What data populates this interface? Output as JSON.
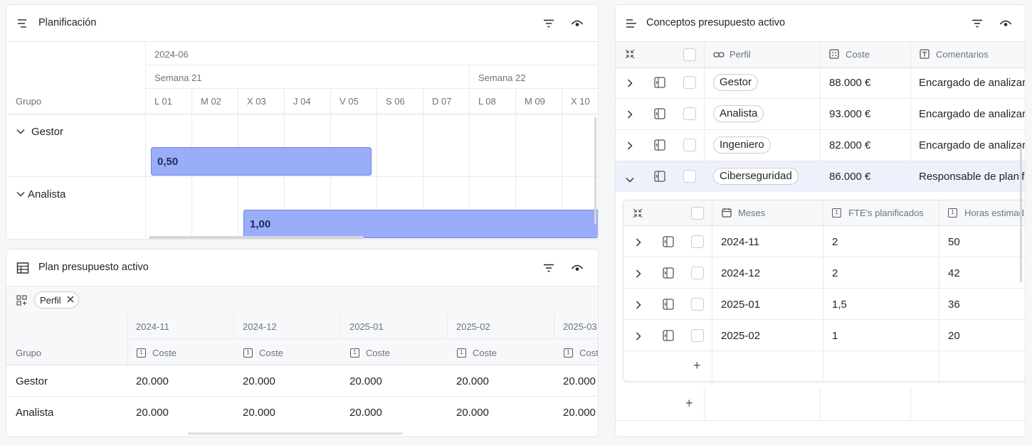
{
  "planificacion": {
    "title": "Planificación",
    "month": "2024-06",
    "weeks": [
      "Semana 21",
      "Semana 22"
    ],
    "group_label": "Grupo",
    "days": [
      "L 01",
      "M 02",
      "X 03",
      "J 04",
      "V 05",
      "S 06",
      "D 07",
      "L 08",
      "M 09",
      "X 10"
    ],
    "groups": [
      "Gestor",
      "Analista"
    ],
    "bars": [
      "0,50",
      "1,00"
    ]
  },
  "plan": {
    "title": "Plan presupuesto activo",
    "chip": "Perfil",
    "months": [
      "2024-11",
      "2024-12",
      "2025-01",
      "2025-02",
      "2025-03"
    ],
    "group_label": "Grupo",
    "sub_label": "Coste",
    "rows": [
      {
        "group": "Gestor",
        "values": [
          "20.000",
          "20.000",
          "20.000",
          "20.000",
          "20.000"
        ]
      },
      {
        "group": "Analista",
        "values": [
          "20.000",
          "20.000",
          "20.000",
          "20.000",
          "20.000"
        ]
      }
    ]
  },
  "conceptos": {
    "title": "Conceptos presupuesto activo",
    "columns": {
      "perfil": "Perfil",
      "coste": "Coste",
      "comentarios": "Comentarios"
    },
    "rows": [
      {
        "perfil": "Gestor",
        "coste": "88.000 €",
        "comentario": "Encargado de analizar"
      },
      {
        "perfil": "Analista",
        "coste": "93.000 €",
        "comentario": "Encargado de analizar"
      },
      {
        "perfil": "Ingeniero",
        "coste": "82.000 €",
        "comentario": "Encargado de analizar"
      },
      {
        "perfil": "Ciberseguridad",
        "coste": "86.000 €",
        "comentario": "Responsable de planif"
      }
    ],
    "sub": {
      "columns": {
        "meses": "Meses",
        "fte": "FTE's planificados",
        "horas": "Horas estimad"
      },
      "rows": [
        {
          "mes": "2024-11",
          "fte": "2",
          "horas": "50"
        },
        {
          "mes": "2024-12",
          "fte": "2",
          "horas": "42"
        },
        {
          "mes": "2025-01",
          "fte": "1,5",
          "horas": "36"
        },
        {
          "mes": "2025-02",
          "fte": "1",
          "horas": "20"
        }
      ]
    },
    "add_symbol": "+"
  },
  "icons": {
    "filter": "filter-icon",
    "eye": "eye-icon",
    "accent": "#9aadf9",
    "selected_row": "#eef1fb"
  }
}
